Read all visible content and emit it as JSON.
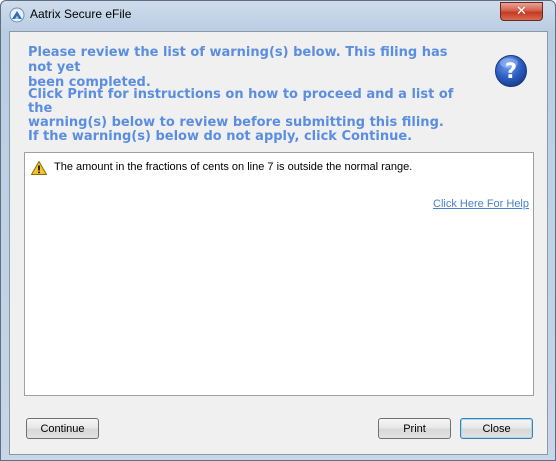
{
  "window": {
    "title": "Aatrix Secure eFile",
    "close_glyph": "✕"
  },
  "message": {
    "heading": "Please review the list of warning(s) below. This filing has not yet\nbeen completed.",
    "instructions": "Click Print for instructions on how to proceed and a list of the\nwarning(s) below to review before submitting this filing.\nIf the warning(s) below do not apply,  click Continue."
  },
  "warnings": {
    "items": [
      {
        "text": "The amount in the fractions of cents on line 7 is outside the normal range.",
        "icon": "warning-icon"
      }
    ],
    "help_link": "Click Here For Help"
  },
  "buttons": {
    "continue": "Continue",
    "print": "Print",
    "close": "Close"
  },
  "colors": {
    "heading_text": "#5b8ee0",
    "link": "#4a7fd0",
    "close_button": "#c23a22"
  }
}
